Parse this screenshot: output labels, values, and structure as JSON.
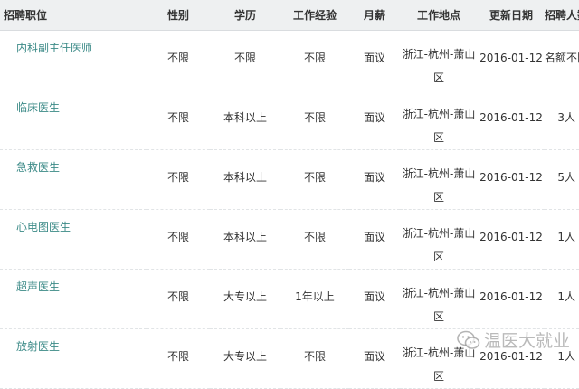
{
  "headers": [
    "招聘职位",
    "性别",
    "学历",
    "工作经验",
    "月薪",
    "工作地点",
    "更新日期",
    "招聘人数"
  ],
  "rows": [
    {
      "title": "内科副主任医师",
      "gender": "不限",
      "education": "不限",
      "experience": "不限",
      "salary": "面议",
      "location": "浙江-杭州-萧山区",
      "date": "2016-01-12",
      "headcount": "名额不限"
    },
    {
      "title": "临床医生",
      "gender": "不限",
      "education": "本科以上",
      "experience": "不限",
      "salary": "面议",
      "location": "浙江-杭州-萧山区",
      "date": "2016-01-12",
      "headcount": "3人"
    },
    {
      "title": "急救医生",
      "gender": "不限",
      "education": "本科以上",
      "experience": "不限",
      "salary": "面议",
      "location": "浙江-杭州-萧山区",
      "date": "2016-01-12",
      "headcount": "5人"
    },
    {
      "title": "心电图医生",
      "gender": "不限",
      "education": "本科以上",
      "experience": "不限",
      "salary": "面议",
      "location": "浙江-杭州-萧山区",
      "date": "2016-01-12",
      "headcount": "1人"
    },
    {
      "title": "超声医生",
      "gender": "不限",
      "education": "大专以上",
      "experience": "1年以上",
      "salary": "面议",
      "location": "浙江-杭州-萧山区",
      "date": "2016-01-12",
      "headcount": "1人"
    },
    {
      "title": "放射医生",
      "gender": "不限",
      "education": "大专以上",
      "experience": "不限",
      "salary": "面议",
      "location": "浙江-杭州-萧山区",
      "date": "2016-01-12",
      "headcount": "1人"
    }
  ],
  "watermark": {
    "text": "温医大就业",
    "icon": "wechat-icon"
  },
  "colors": {
    "link": "#3b8a87",
    "header_bg": "#eef0f1",
    "text": "#333333"
  }
}
